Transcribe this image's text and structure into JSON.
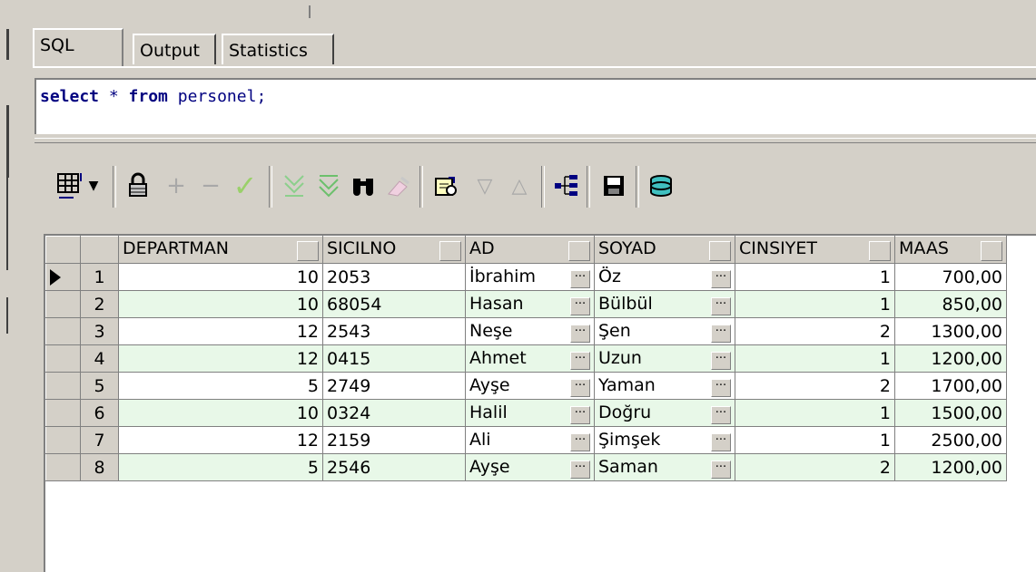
{
  "tabs": [
    {
      "label": "SQL",
      "active": true
    },
    {
      "label": "Output",
      "active": false
    },
    {
      "label": "Statistics",
      "active": false
    }
  ],
  "editor": {
    "kw_select": "select",
    "star": " * ",
    "kw_from": "from",
    "table": " personel;"
  },
  "toolbar": {
    "icons": [
      "grid-view-icon",
      "dropdown-arrow-icon",
      "lock-icon",
      "add-record-icon",
      "delete-record-icon",
      "post-edit-icon",
      "filter-down-icon",
      "filter-up-icon",
      "binoculars-find-icon",
      "eraser-icon",
      "query-by-example-icon",
      "triangle-down-icon",
      "triangle-up-icon",
      "tree-icon",
      "save-floppy-icon",
      "database-icon"
    ]
  },
  "grid": {
    "columns": [
      "DEPARTMAN",
      "SICILNO",
      "AD",
      "SOYAD",
      "CINSIYET",
      "MAAS"
    ],
    "rows": [
      {
        "no": "1",
        "departman": "10",
        "sicilno": "2053",
        "ad": "İbrahim",
        "soyad": "Öz",
        "cinsiyet": "1",
        "maas": "700,00"
      },
      {
        "no": "2",
        "departman": "10",
        "sicilno": "68054",
        "ad": "Hasan",
        "soyad": "Bülbül",
        "cinsiyet": "1",
        "maas": "850,00"
      },
      {
        "no": "3",
        "departman": "12",
        "sicilno": "2543",
        "ad": "Neşe",
        "soyad": "Şen",
        "cinsiyet": "2",
        "maas": "1300,00"
      },
      {
        "no": "4",
        "departman": "12",
        "sicilno": "0415",
        "ad": "Ahmet",
        "soyad": "Uzun",
        "cinsiyet": "1",
        "maas": "1200,00"
      },
      {
        "no": "5",
        "departman": "5",
        "sicilno": "2749",
        "ad": "Ayşe",
        "soyad": "Yaman",
        "cinsiyet": "2",
        "maas": "1700,00"
      },
      {
        "no": "6",
        "departman": "10",
        "sicilno": "0324",
        "ad": "Halil",
        "soyad": "Doğru",
        "cinsiyet": "1",
        "maas": "1500,00"
      },
      {
        "no": "7",
        "departman": "12",
        "sicilno": "2159",
        "ad": "Ali",
        "soyad": "Şimşek",
        "cinsiyet": "1",
        "maas": "2500,00"
      },
      {
        "no": "8",
        "departman": "5",
        "sicilno": "2546",
        "ad": "Ayşe",
        "soyad": "Saman",
        "cinsiyet": "2",
        "maas": "1200,00"
      }
    ]
  },
  "colors": {
    "alt_row": "#e8f8e8",
    "keyword": "#000080",
    "chrome": "#d4d0c8"
  }
}
